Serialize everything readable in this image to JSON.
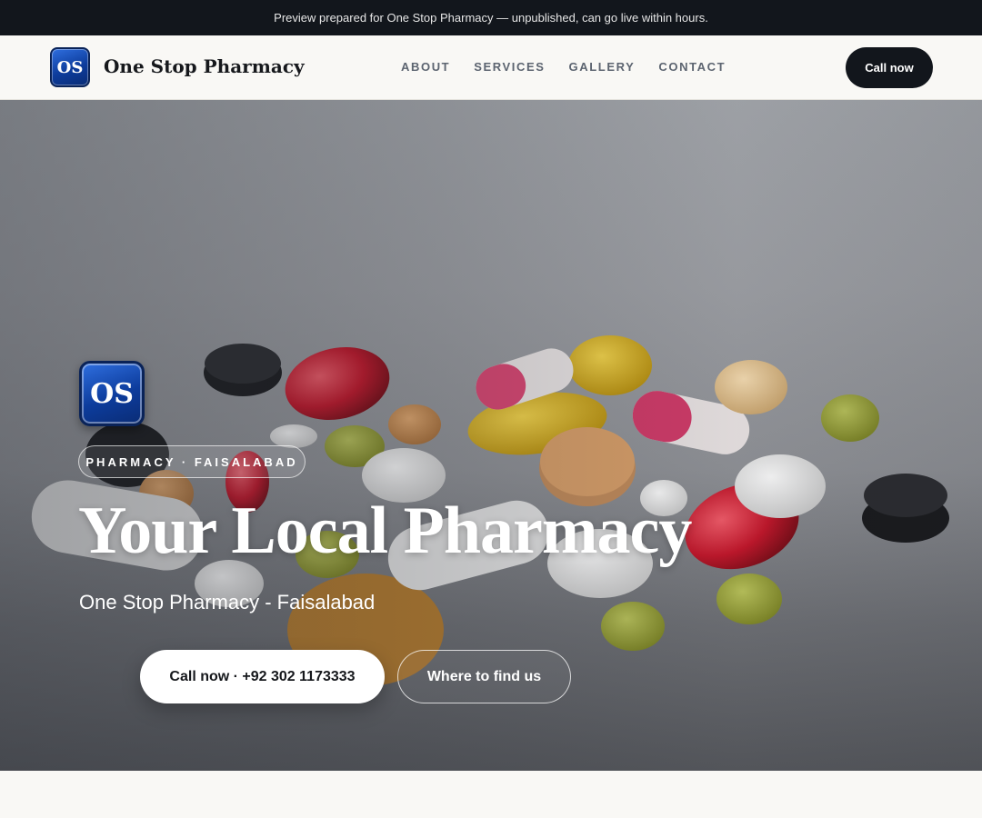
{
  "banner": {
    "text": "Preview prepared for One Stop Pharmacy — unpublished, can go live within hours."
  },
  "header": {
    "logo_text": "OS",
    "brand_name": "One Stop Pharmacy",
    "nav": [
      "ABOUT",
      "SERVICES",
      "GALLERY",
      "CONTACT"
    ],
    "cta_label": "Call now"
  },
  "hero": {
    "logo_text": "OS",
    "badge": "PHARMACY · FAISALABAD",
    "title": "Your Local Pharmacy",
    "subtitle": "One Stop Pharmacy - Faisalabad",
    "primary_button": "Call now · +92 302 1173333",
    "secondary_button": "Where to find us",
    "background_image": "assorted-pills-photo"
  }
}
